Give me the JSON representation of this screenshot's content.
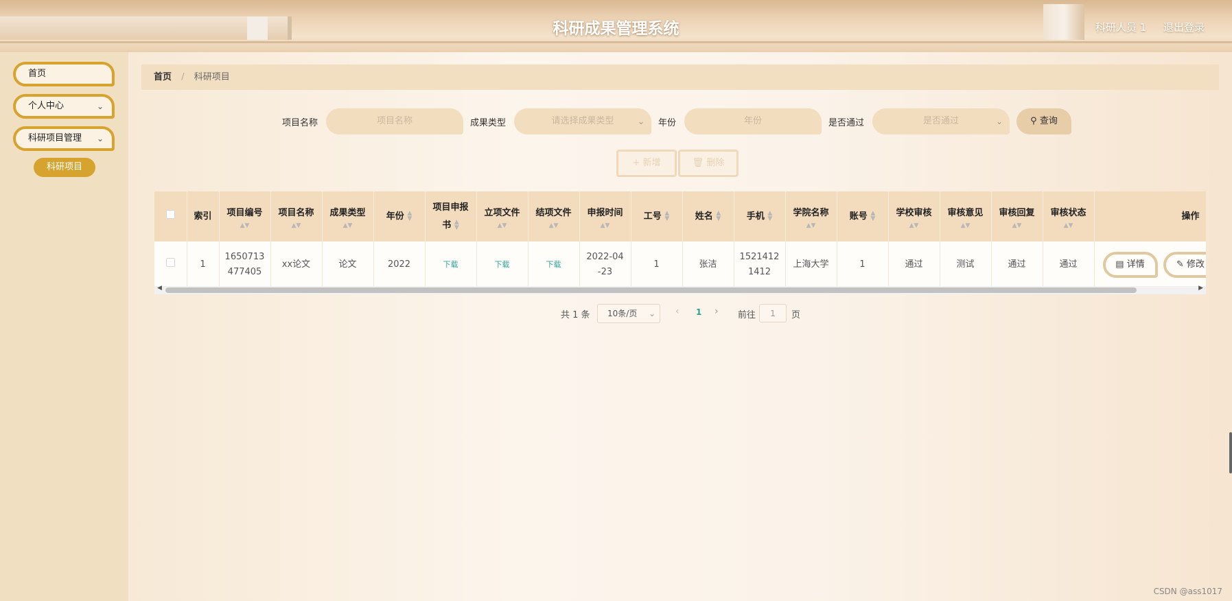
{
  "header": {
    "title": "科研成果管理系统",
    "user": "科研人员 1",
    "logout": "退出登录"
  },
  "sidebar": {
    "items": [
      {
        "label": "首页"
      },
      {
        "label": "个人中心",
        "chevron": "chevron-down-icon"
      },
      {
        "label": "科研项目管理",
        "chevron": "chevron-down-icon"
      }
    ],
    "active_sub": "科研项目"
  },
  "breadcrumb": {
    "home": "首页",
    "sep": "/",
    "current": "科研项目"
  },
  "search": {
    "name_label": "项目名称",
    "name_placeholder": "项目名称",
    "type_label": "成果类型",
    "type_placeholder": "请选择成果类型",
    "year_label": "年份",
    "year_placeholder": "年份",
    "pass_label": "是否通过",
    "pass_placeholder": "是否通过",
    "query_button": "查询"
  },
  "actions": {
    "add": "新增",
    "delete": "删除"
  },
  "table": {
    "headers": {
      "index": "索引",
      "code": "项目编号",
      "name": "项目名称",
      "type": "成果类型",
      "year": "年份",
      "proposal_1": "项目申报",
      "proposal_2": "书",
      "approval_doc": "立项文件",
      "final_doc": "结项文件",
      "apply_time": "申报时间",
      "staff_id": "工号",
      "person": "姓名",
      "phone": "手机",
      "college": "学院名称",
      "account": "账号",
      "school_review": "学校审核",
      "review_opinion": "审核意见",
      "review_reply": "审核回复",
      "review_status": "审核状态",
      "ops": "操作"
    },
    "row": {
      "index": "1",
      "code_1": "1650713",
      "code_2": "477405",
      "name": "xx论文",
      "type": "论文",
      "year": "2022",
      "proposal": "下载",
      "approval_doc": "下载",
      "final_doc": "下载",
      "apply_time_1": "2022-04",
      "apply_time_2": "-23",
      "staff_id": "1",
      "person": "张洁",
      "phone_1": "1521412",
      "phone_2": "1412",
      "college": "上海大学",
      "account": "1",
      "school_review": "通过",
      "review_opinion": "测试",
      "review_reply": "通过",
      "review_status": "通过",
      "detail": "详情",
      "edit": "修改"
    }
  },
  "pager": {
    "total": "共 1 条",
    "size": "10条/页",
    "page": "1",
    "goto": "前往",
    "goto_value": "1",
    "page_unit": "页"
  },
  "watermark": "CSDN @ass1017",
  "colors": {
    "accent": "#d6a32f",
    "header_bg": "#e9cfae",
    "sidebar_bg": "#f1dfc2",
    "link": "#2fa79a"
  }
}
